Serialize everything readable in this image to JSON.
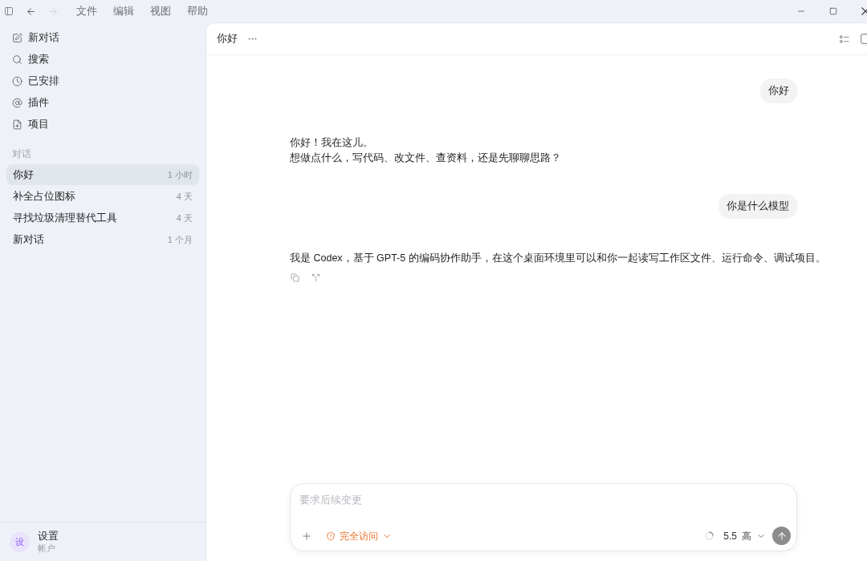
{
  "title_bar": {
    "navigation": [
      {
        "kind": "back",
        "disabled": false
      },
      {
        "kind": "forward",
        "disabled": true
      }
    ],
    "menus": [
      "文件",
      "编辑",
      "视图",
      "帮助"
    ]
  },
  "sidebar": {
    "nav_items": [
      "新对话",
      "搜索",
      "已安排",
      "插件",
      "项目"
    ],
    "section_title": "对话",
    "conversations": [
      {
        "title": "你好",
        "time": "1 小时",
        "selected": true
      },
      {
        "title": "补全占位图标",
        "time": "4 天",
        "selected": false
      },
      {
        "title": "寻找垃圾清理替代工具",
        "time": "4 天",
        "selected": false
      },
      {
        "title": "新对话",
        "time": "1 个月",
        "selected": false
      }
    ],
    "account": {
      "avatar": "设",
      "name": "设置",
      "subtitle": "帐户"
    }
  },
  "chat": {
    "title": "你好",
    "messages": [
      {
        "kind": "user",
        "lines": [
          "你好"
        ]
      },
      {
        "kind": "assistant",
        "lines": [
          "你好！我在这儿。",
          "想做点什么，写代码、改文件、查资料，还是先聊聊思路？"
        ],
        "show_actions": false
      },
      {
        "kind": "user",
        "lines": [
          "你是什么模型"
        ]
      },
      {
        "kind": "assistant",
        "lines": [
          "我是 Codex，基于 GPT-5 的编码协作助手，在这个桌面环境里可以和你一起读写工作区文件、运行命令、调试项目。"
        ],
        "show_actions": true
      }
    ]
  },
  "composer": {
    "placeholder": "要求后续变更",
    "access": "完全访问",
    "model": "5.5",
    "effort": "高"
  }
}
